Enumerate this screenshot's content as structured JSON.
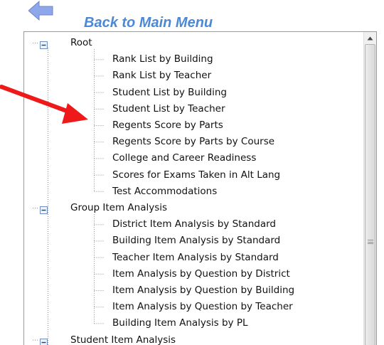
{
  "header": {
    "back_label": "Back to Main Menu"
  },
  "colors": {
    "link_blue": "#4b89d6",
    "arrow_blue": "#8ea6ea",
    "annotation_red": "#ee1a1a"
  },
  "tree": {
    "groups": [
      {
        "label": "Root",
        "expanded": true,
        "children": [
          "Rank List by Building",
          "Rank List by Teacher",
          "Student List by Building",
          "Student List by Teacher",
          "Regents Score by Parts",
          "Regents Score by Parts by Course",
          "College and Career Readiness",
          "Scores for Exams Taken in Alt Lang",
          "Test Accommodations"
        ]
      },
      {
        "label": "Group Item Analysis",
        "expanded": true,
        "children": [
          "District Item Analysis by Standard",
          "Building Item Analysis by Standard",
          "Teacher Item Analysis by Standard",
          "Item Analysis by Question by District",
          "Item Analysis by Question by Building",
          "Item Analysis by Question by Teacher",
          "Building Item Analysis by PL"
        ]
      },
      {
        "label": "Student Item Analysis",
        "expanded": true,
        "children": []
      }
    ]
  },
  "icons": {
    "back": "back-arrow-icon",
    "expander": "minus-expander-icon",
    "annotation": "red-pointer-arrow-icon"
  }
}
